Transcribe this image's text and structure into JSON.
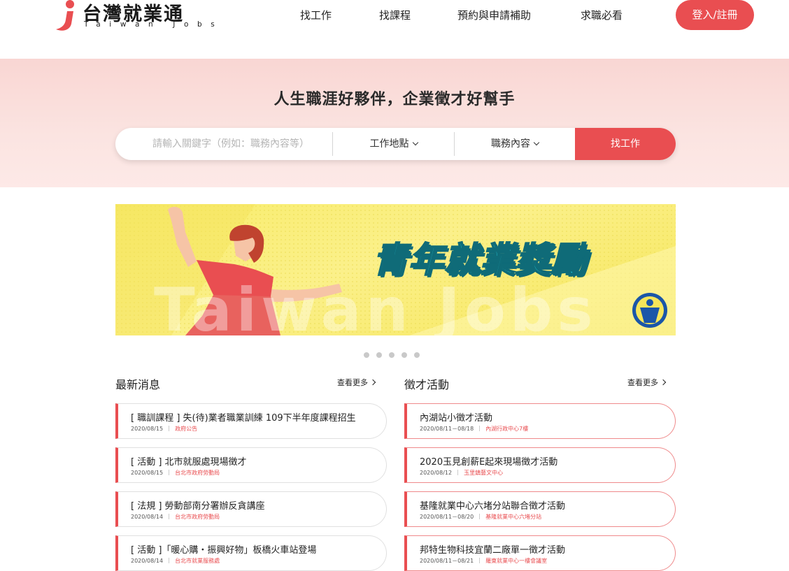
{
  "header": {
    "logo_text": "台灣就業通",
    "logo_sub": "Taiwan Jobs",
    "nav": [
      "找工作",
      "找課程",
      "預約與申請補助",
      "求職必看"
    ],
    "login": "登入/註冊"
  },
  "hero": {
    "title": "人生職涯好夥伴，企業徵才好幫手",
    "search_placeholder": "請輸入關鍵字（例如：職務內容等）",
    "location": "工作地點",
    "category": "職務內容",
    "search_button": "找工作"
  },
  "banner": {
    "title": "青年就業獎勵",
    "watermark": "Taiwan Jobs"
  },
  "carousel": {
    "dots": 5
  },
  "news": {
    "title": "最新消息",
    "more": "查看更多",
    "items": [
      {
        "title": "[ 職訓課程 ] 失(待)業者職業訓練 109下半年度課程招生",
        "date": "2020/08/15",
        "source": "政府公告"
      },
      {
        "title": "[ 活動 ] 北市就服處現場徵才",
        "date": "2020/08/15",
        "source": "台北市政府勞動局"
      },
      {
        "title": "[ 法規 ] 勞動部南分署辦反貪講座",
        "date": "2020/08/14",
        "source": "台北市政府勞動局"
      },
      {
        "title": "[ 活動 ]「暖心購・振興好物」板橋火車站登場",
        "date": "2020/08/14",
        "source": "台北市就業服務處"
      }
    ]
  },
  "events": {
    "title": "徵才活動",
    "more": "查看更多",
    "items": [
      {
        "title": "內湖站小徵才活動",
        "date": "2020/08/11－08/18",
        "source": "內湖行政中心7樓"
      },
      {
        "title": "2020玉見創薪E起來現場徵才活動",
        "date": "2020/08/12",
        "source": "玉里鎮藝文中心"
      },
      {
        "title": "基隆就業中心六堵分站聯合徵才活動",
        "date": "2020/08/11－08/20",
        "source": "基隆就業中心六堵分站"
      },
      {
        "title": "邦特生物科技宜蘭二廠單一徵才活動",
        "date": "2020/08/11－08/21",
        "source": "羅東就業中心一樓會議室"
      }
    ]
  },
  "colors": {
    "accent": "#e94e51",
    "hero_bg": "#fbe0dd",
    "banner_bg": "#f9ee78",
    "banner_title": "#26d4e4"
  }
}
